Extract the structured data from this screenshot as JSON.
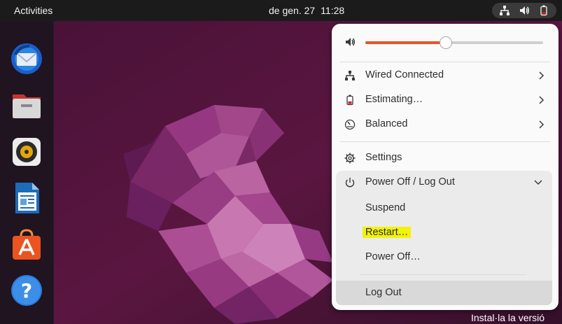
{
  "topbar": {
    "activities": "Activities",
    "date": "de gen. 27",
    "time": "11:28",
    "tray_icons": [
      "network-icon",
      "volume-icon",
      "battery-icon"
    ]
  },
  "dock": {
    "apps": [
      "Thunderbird Mail",
      "Files",
      "Rhythmbox",
      "LibreOffice Writer",
      "Ubuntu Software",
      "Help"
    ]
  },
  "menu": {
    "volume_level": 0.45,
    "accent_color": "#e95420",
    "items": [
      {
        "label": "Wired Connected",
        "icon": "network-icon"
      },
      {
        "label": "Estimating…",
        "icon": "battery-icon"
      },
      {
        "label": "Balanced",
        "icon": "power-profile-icon"
      }
    ],
    "settings_label": "Settings",
    "power_header": "Power Off / Log Out",
    "power_items": [
      "Suspend",
      "Restart…",
      "Power Off…"
    ],
    "logout_label": "Log Out",
    "highlight_color": "#f2f20a"
  },
  "desktop": {
    "install_text": "Instal·la la versió"
  }
}
